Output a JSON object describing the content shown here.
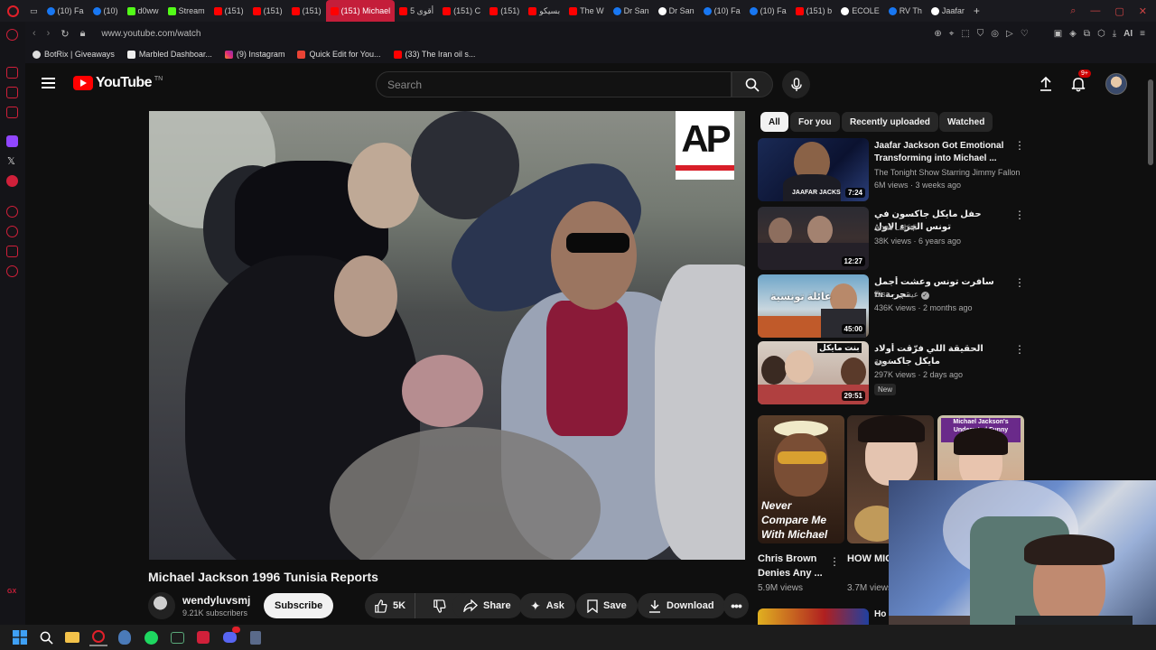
{
  "browser": {
    "tabs": [
      {
        "label": "(10) Fa",
        "icon": "facebook"
      },
      {
        "label": "(10)",
        "icon": "facebook"
      },
      {
        "label": "d0ww",
        "icon": "kick"
      },
      {
        "label": "Stream",
        "icon": "kick"
      },
      {
        "label": "(151)",
        "icon": "youtube"
      },
      {
        "label": "(151)",
        "icon": "youtube"
      },
      {
        "label": "(151)",
        "icon": "youtube"
      },
      {
        "label": "(151) Michael",
        "icon": "youtube",
        "active": true
      },
      {
        "label": "5 أقوى",
        "icon": "youtube"
      },
      {
        "label": "(151) C",
        "icon": "youtube"
      },
      {
        "label": "(151)",
        "icon": "youtube"
      },
      {
        "label": "بسيكو",
        "icon": "youtube"
      },
      {
        "label": "The W",
        "icon": "red"
      },
      {
        "label": "Dr San",
        "icon": "blue"
      },
      {
        "label": "Dr San",
        "icon": "google"
      },
      {
        "label": "(10) Fa",
        "icon": "facebook"
      },
      {
        "label": "(10) Fa",
        "icon": "facebook"
      },
      {
        "label": "(151) b",
        "icon": "youtube"
      },
      {
        "label": "ECOLE",
        "icon": "google"
      },
      {
        "label": "RV Th",
        "icon": "blue"
      },
      {
        "label": "Jaafar",
        "icon": "google"
      }
    ],
    "url": "www.youtube.com/watch",
    "bookmarks": [
      "BotRix | Giveaways",
      "Marbled Dashboar...",
      "(9) Instagram",
      "Quick Edit for You...",
      "(33) The Iran oil s..."
    ],
    "ai_label": "AI"
  },
  "youtube": {
    "logo_text": "YouTube",
    "logo_region": "TN",
    "search_placeholder": "Search",
    "notification_count": "9+"
  },
  "video": {
    "title": "Michael Jackson 1996 Tunisia Reports",
    "watermark": "AP",
    "channel": "wendyluvsmj",
    "subscribers": "9.21K subscribers",
    "subscribe_label": "Subscribe",
    "likes": "5K",
    "share_label": "Share",
    "ask_label": "Ask",
    "save_label": "Save",
    "download_label": "Download"
  },
  "chips": [
    "All",
    "For you",
    "Recently uploaded",
    "Watched"
  ],
  "recommendations": [
    {
      "title": "Jaafar Jackson Got Emotional Transforming into Michael ...",
      "channel": "The Tonight Show Starring Jimmy Fallon",
      "meta": "6M views · 3 weeks ago",
      "duration": "7:24",
      "thumb_text": "JAAFAR JACKS"
    },
    {
      "title": "حفل مايكل جاكسون في تونس الجزء الاول",
      "channel": "Anas Labidi",
      "meta": "38K views · 6 years ago",
      "duration": "12:27"
    },
    {
      "title": "سافرت تونس وعشت أجمل تجربة",
      "channel": "Eisa - عيسى",
      "meta": "436K views · 2 months ago",
      "duration": "45:00",
      "thumb_text": "عائلة تونسية",
      "badge": "TN"
    },
    {
      "title": "الحقيقة اللي فرّقت أولاد مايكل جاكسون",
      "channel": "عربية",
      "meta": "297K views · 2 days ago",
      "duration": "29:51",
      "thumb_text": "بنت مايكل",
      "new_label": "New"
    }
  ],
  "shorts": [
    {
      "title": "Chris Brown Denies Any ...",
      "views": "5.9M views",
      "overlay": "Never Compare Me With Michael"
    },
    {
      "title": "HOW MICHAE...",
      "views": "3.7M views"
    },
    {
      "overlay": "Michael Jackson's Underrated Funny Moments"
    }
  ],
  "next_short_title": "Ho",
  "colors": {
    "yt_red": "#ff0000",
    "opera_red": "#e0202a",
    "bg": "#0f0f0f",
    "chip": "#272727"
  }
}
